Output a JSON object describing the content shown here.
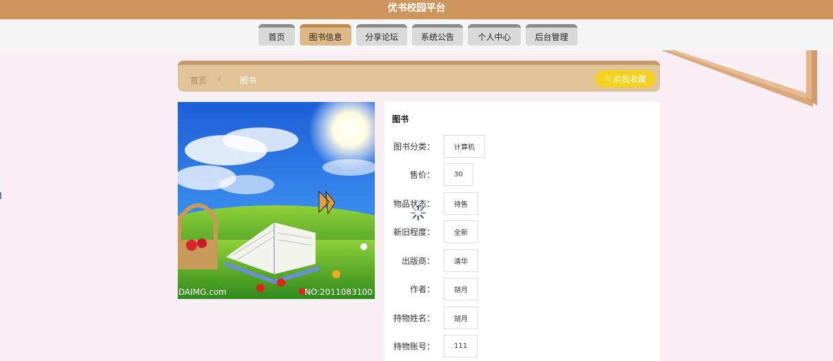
{
  "app": {
    "title": "优书校园平台"
  },
  "nav": {
    "items": [
      {
        "label": "首页",
        "active": false
      },
      {
        "label": "图书信息",
        "active": true
      },
      {
        "label": "分享论坛",
        "active": false
      },
      {
        "label": "系统公告",
        "active": false
      },
      {
        "label": "个人中心",
        "active": false
      },
      {
        "label": "后台管理",
        "active": false
      }
    ]
  },
  "breadcrumb": {
    "home": "首页",
    "separator": "/",
    "current": "图书"
  },
  "favorite": {
    "icon": "star-outline-icon",
    "label": "点我收藏"
  },
  "image": {
    "watermark_left": "DAIMG.com",
    "watermark_right": "NO:2011083100"
  },
  "detail": {
    "title": "图书",
    "fields": [
      {
        "label": "图书分类：",
        "value": "计算机"
      },
      {
        "label": "售价：",
        "value": "30"
      },
      {
        "label": "物品状态：",
        "value": "待售"
      },
      {
        "label": "新旧程度：",
        "value": "全新"
      },
      {
        "label": "出版商：",
        "value": "清华"
      },
      {
        "label": "作者：",
        "value": "胡月"
      },
      {
        "label": "持物姓名：",
        "value": "胡月"
      },
      {
        "label": "持物账号：",
        "value": "111"
      }
    ]
  },
  "colors": {
    "header": "#cd955c",
    "nav_active": "#deb887",
    "nav_inactive": "#d9d9d9",
    "breadcrumb_bg": "#e1c398",
    "favorite_btn": "#f2d21f",
    "page_bg": "#f7eff4"
  }
}
